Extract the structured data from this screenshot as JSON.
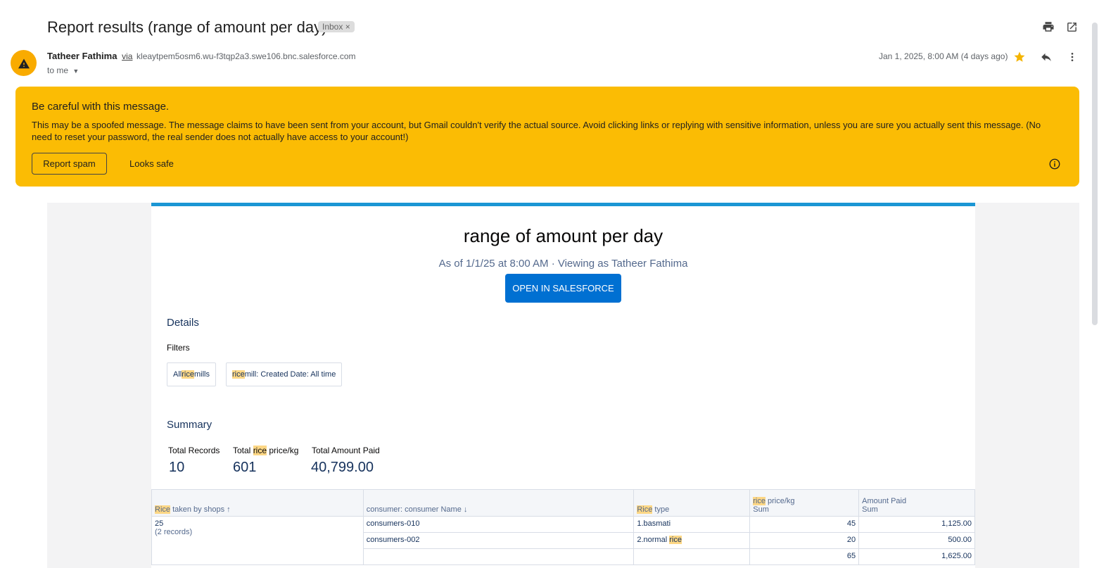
{
  "email": {
    "subject": "Report results (range of amount per day)",
    "label_chip": "Inbox ×",
    "sender_name": "Tatheer Fathima",
    "via": "via",
    "sender_address": "kleaytpem5osm6.wu-f3tqp2a3.swe106.bnc.salesforce.com",
    "to": "to me",
    "date": "Jan 1, 2025, 8:00 AM (4 days ago)"
  },
  "warning": {
    "title": "Be careful with this message.",
    "text": "This may be a spoofed message. The message claims to have been sent from your account, but Gmail couldn't verify the actual source. Avoid clicking links or replying with sensitive information, unless you are sure you actually sent this message. (No need to reset your password, the real sender does not actually have access to your account!)",
    "report_spam": "Report spam",
    "looks_safe": "Looks safe"
  },
  "report": {
    "title": "range of amount per day",
    "as_of": "As of 1/1/25 at 8:00 AM · Viewing as Tatheer Fathima",
    "open_button": "OPEN IN SALESFORCE",
    "details_title": "Details",
    "filters_label": "Filters",
    "filter1": {
      "pre": "All ",
      "hl": "rice",
      "post": " mills"
    },
    "filter2": {
      "pre": "",
      "hl": "rice",
      "post": " mill: Created Date: All time"
    },
    "summary_title": "Summary",
    "summary": {
      "records_label": "Total Records",
      "records_value": "10",
      "price_label_pre": "Total ",
      "price_label_hl": "rice",
      "price_label_post": " price/kg",
      "price_value": "601",
      "amount_label": "Total Amount Paid",
      "amount_value": "40,799.00"
    },
    "table": {
      "col1_hl": "Rice",
      "col1_post": " taken by shops ↑",
      "col2": "consumer: consumer Name ↓",
      "col3_hl": "Rice",
      "col3_post": " type",
      "col4_hl": "rice",
      "col4_post": " price/kg",
      "col4_sub": "Sum",
      "col5": "Amount Paid",
      "col5_sub": "Sum",
      "group_value": "25",
      "group_records": "(2 records)",
      "row1": {
        "consumer": "consumers-010",
        "type": "1.basmati",
        "price": "45",
        "amount": "1,125.00"
      },
      "row2": {
        "consumer": "consumers-002",
        "type_pre": "2.normal ",
        "type_hl": "rice",
        "price": "20",
        "amount": "500.00"
      },
      "subtotal": {
        "price": "65",
        "amount": "1,625.00"
      }
    }
  },
  "colors": {
    "warning_bg": "#fbbc04",
    "star": "#f4b400",
    "accent_blue": "#0070d2",
    "highlight": "#fdd785"
  }
}
